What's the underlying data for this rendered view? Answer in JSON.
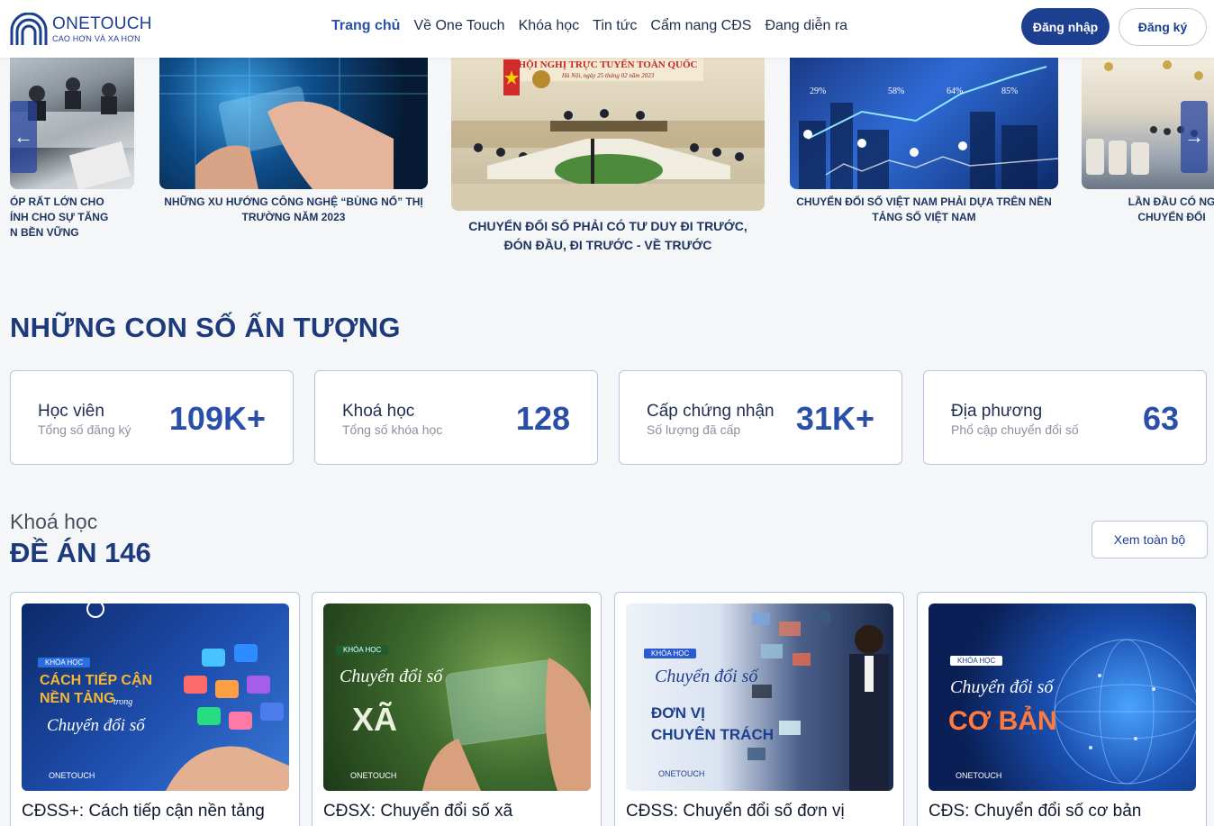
{
  "brand": {
    "name": "ONETOUCH",
    "tagline": "CAO HƠN VÀ XA HƠN"
  },
  "nav": {
    "items": [
      "Trang chủ",
      "Về One Touch",
      "Khóa học",
      "Tin tức",
      "Cẩm nang CĐS",
      "Đang diễn ra"
    ],
    "active_index": 0
  },
  "auth": {
    "login": "Đăng nhập",
    "register": "Đăng ký"
  },
  "carousel": {
    "prev": "←",
    "next": "→",
    "slides": [
      {
        "caption_lines": [
          "ÓP RẤT LỚN CHO",
          "ÍNH CHO SỰ TĂNG",
          "N BỀN VỮNG"
        ]
      },
      {
        "caption_lines": [
          "NHỮNG XU HƯỚNG CÔNG NGHỆ “BÙNG NỔ” THỊ",
          "TRƯỜNG NĂM 2023"
        ]
      },
      {
        "caption_lines": [
          "CHUYỂN ĐỔI SỐ PHẢI CÓ TƯ DUY ĐI TRƯỚC,",
          "ĐÓN ĐẦU, ĐI TRƯỚC - VỀ TRƯỚC"
        ],
        "banner": "HỘI NGHỊ TRỰC TUYẾN TOÀN QUỐC",
        "banner_sub": "Hà Nội, ngày 25 tháng 02 năm 2023"
      },
      {
        "caption_lines": [
          "CHUYỂN ĐỔI SỐ VIỆT NAM PHẢI DỰA TRÊN NỀN",
          "TẢNG SỐ VIỆT NAM"
        ],
        "overlay_numbers": [
          "29%",
          "58%",
          "64%",
          "85%"
        ]
      },
      {
        "caption_lines": [
          "LẦN ĐẦU CÓ NG",
          "CHUYỂN ĐỔI"
        ]
      }
    ]
  },
  "stats_section": {
    "title": "NHỮNG CON SỐ ẤN TƯỢNG",
    "items": [
      {
        "label": "Học viên",
        "sub": "Tổng số đăng ký",
        "value": "109K+"
      },
      {
        "label": "Khoá học",
        "sub": "Tổng số khóa học",
        "value": "128"
      },
      {
        "label": "Cấp chứng nhận",
        "sub": "Số lượng đã cấp",
        "value": "31K+"
      },
      {
        "label": "Địa phương",
        "sub": "Phổ cập chuyển đổi số",
        "value": "63"
      }
    ]
  },
  "courses_section": {
    "kicker": "Khoá học",
    "title": "ĐỀ ÁN 146",
    "view_all": "Xem toàn bộ",
    "items": [
      {
        "name": "CĐSS+: Cách tiếp cận nền tảng",
        "thumb_tag": "KHÓA HỌC",
        "thumb_title": "CÁCH TIẾP CẬN",
        "thumb_title2": "NỀN TẢNG",
        "thumb_small": "trong",
        "thumb_script": "Chuyển đổi số",
        "thumb_brand": "ONETOUCH"
      },
      {
        "name": "CĐSX: Chuyển đổi số xã",
        "thumb_tag": "KHÓA HỌC",
        "thumb_script": "Chuyển đổi số",
        "thumb_title": "XÃ",
        "thumb_brand": "ONETOUCH"
      },
      {
        "name": "CĐSS: Chuyển đổi số đơn vị",
        "thumb_tag": "KHÓA HỌC",
        "thumb_script": "Chuyển đổi số",
        "thumb_title": "ĐƠN VỊ",
        "thumb_title2": "CHUYÊN TRÁCH",
        "thumb_brand": "ONETOUCH"
      },
      {
        "name": "CĐS: Chuyển đổi số cơ bản",
        "thumb_tag": "KHÓA HỌC",
        "thumb_script": "Chuyển đổi số",
        "thumb_title": "CƠ BẢN",
        "thumb_brand": "ONETOUCH"
      }
    ]
  }
}
